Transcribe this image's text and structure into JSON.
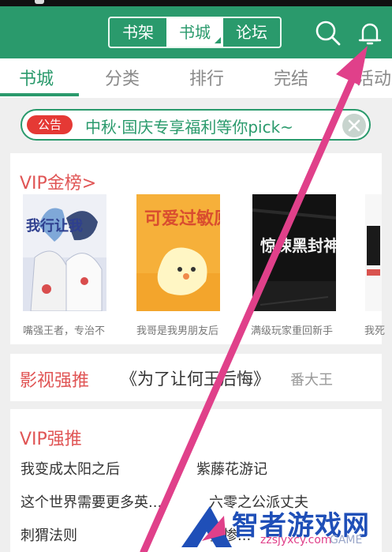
{
  "header": {
    "segments": [
      "书架",
      "书城",
      "论坛"
    ],
    "active_segment": "书城",
    "icons": [
      "search-icon",
      "bell-icon"
    ],
    "colors": {
      "brand": "#2a9a6c",
      "accent_red": "#e05555"
    }
  },
  "tabs": [
    {
      "label": "书城",
      "active": true
    },
    {
      "label": "分类",
      "active": false
    },
    {
      "label": "排行",
      "active": false
    },
    {
      "label": "完结",
      "active": false
    },
    {
      "label": "活动",
      "active": false
    }
  ],
  "notice": {
    "badge": "公告",
    "text": "中秋·国庆专享福利等你pick~",
    "close_icon": "close-icon"
  },
  "vip_gold": {
    "title": "VIP金榜>",
    "books": [
      {
        "title": "嘴强王者，专治不",
        "cover_text": "我行让我"
      },
      {
        "title": "我哥是我男朋友后",
        "cover_text": "可爱过敏原"
      },
      {
        "title": "满级玩家重回新手",
        "cover_text": "惊悚黑封神游戏"
      },
      {
        "title": "我死",
        "cover_text": ""
      }
    ]
  },
  "video_rec": {
    "title": "影视强推",
    "book": "《为了让何王后悔》",
    "author": "番大王"
  },
  "vip_rec": {
    "title": "VIP强推",
    "items": [
      "我变成太阳之后",
      "紫藤花游记",
      "这个世界需要更多英...",
      "六零之公派丈夫",
      "刺猬法则",
      "强惨..."
    ]
  },
  "watermark": {
    "text": "智者游戏网",
    "url": "zzsjyxcy.com",
    "suffix": "GAME"
  }
}
